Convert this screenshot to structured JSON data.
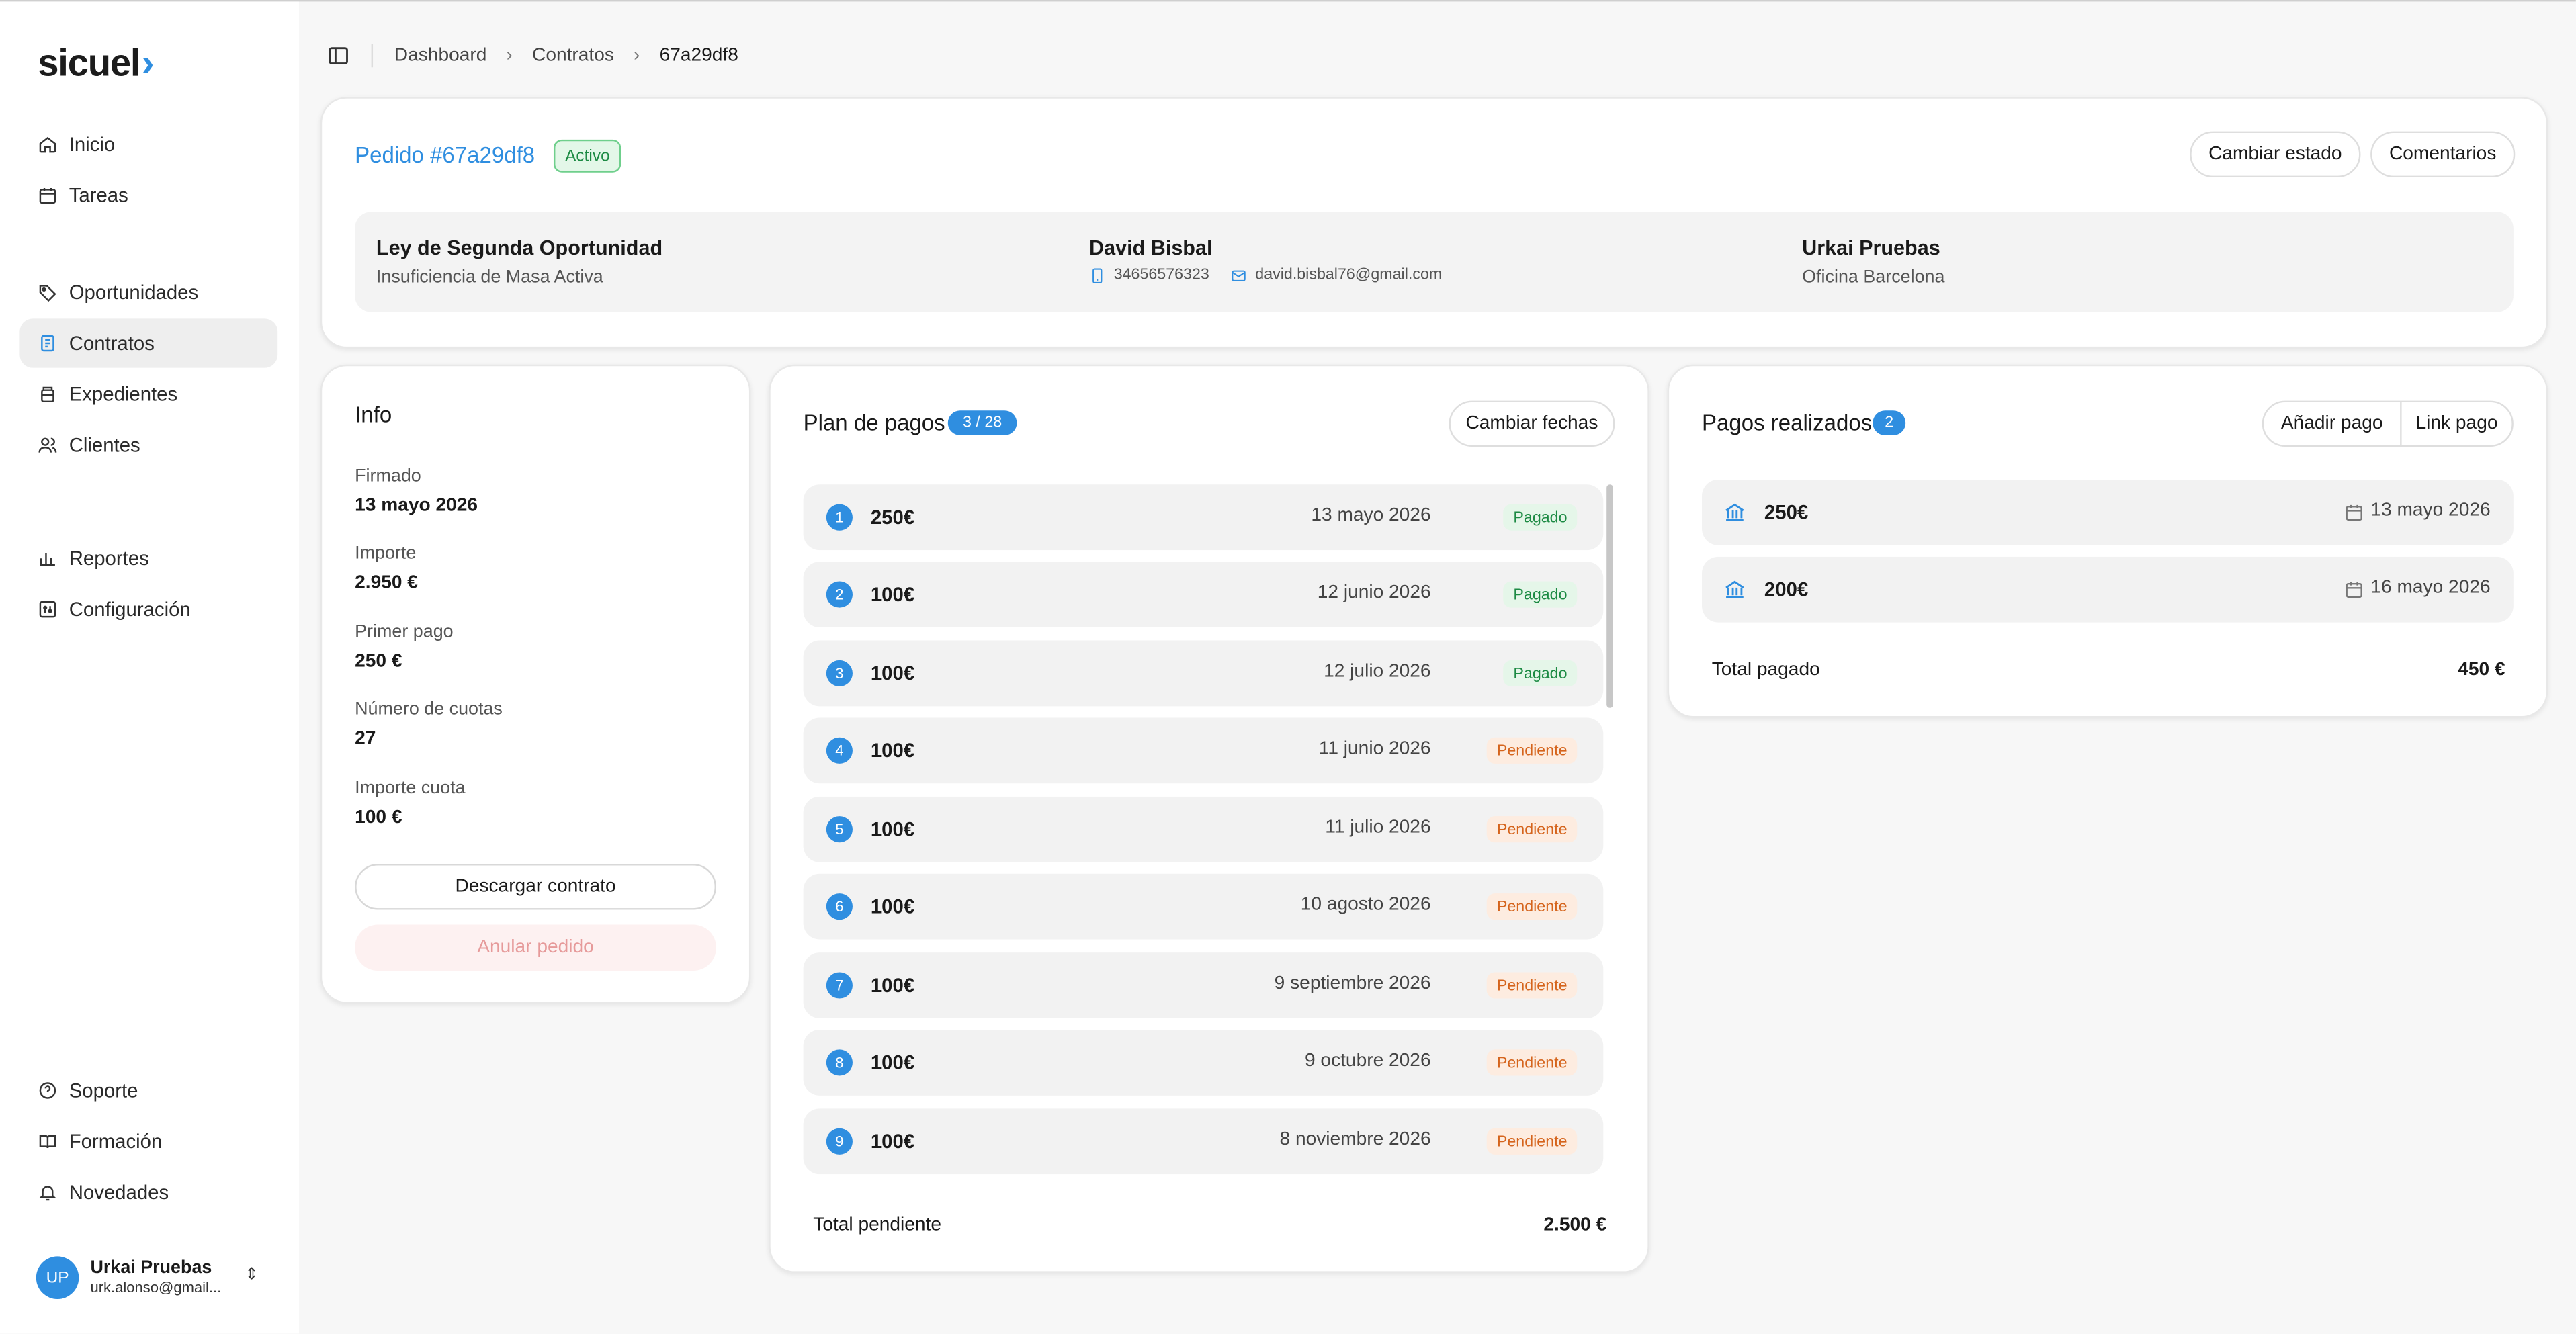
{
  "app": {
    "logo": "sicuel",
    "logo_chevron": "›"
  },
  "colors": {
    "accent": "#2f8ee0",
    "success": "#1c8a43",
    "warning": "#d5641c",
    "danger_soft": "#e69a9a"
  },
  "sidebar": {
    "items": [
      {
        "label": "Inicio",
        "icon": "home-icon"
      },
      {
        "label": "Tareas",
        "icon": "calendar-icon"
      },
      {
        "label": "Oportunidades",
        "icon": "tag-icon"
      },
      {
        "label": "Contratos",
        "icon": "contract-icon",
        "active": true
      },
      {
        "label": "Expedientes",
        "icon": "folder-stack-icon"
      },
      {
        "label": "Clientes",
        "icon": "users-icon"
      },
      {
        "label": "Reportes",
        "icon": "chart-icon"
      },
      {
        "label": "Configuración",
        "icon": "settings-panel-icon"
      },
      {
        "label": "Soporte",
        "icon": "help-circle-icon"
      },
      {
        "label": "Formación",
        "icon": "book-icon"
      },
      {
        "label": "Novedades",
        "icon": "bell-icon"
      }
    ],
    "user": {
      "initials": "UP",
      "name": "Urkai Pruebas",
      "email": "urk.alonso@gmail...",
      "switch_icon": "⇕"
    }
  },
  "breadcrumb": {
    "items": [
      "Dashboard",
      "Contratos"
    ],
    "current": "67a29df8",
    "separator": "›"
  },
  "order": {
    "title": "Pedido #67a29df8",
    "status": "Activo",
    "actions": {
      "change_status": "Cambiar estado",
      "comments": "Comentarios"
    },
    "service": {
      "title": "Ley de Segunda Oportunidad",
      "subtitle": "Insuficiencia de Masa Activa"
    },
    "client": {
      "name": "David Bisbal",
      "phone": "34656576323",
      "email": "david.bisbal76@gmail.com"
    },
    "agent": {
      "name": "Urkai Pruebas",
      "office": "Oficina Barcelona"
    }
  },
  "info": {
    "title": "Info",
    "fields": [
      {
        "label": "Firmado",
        "value": "13 mayo 2026"
      },
      {
        "label": "Importe",
        "value": "2.950 €"
      },
      {
        "label": "Primer pago",
        "value": "250 €"
      },
      {
        "label": "Número de cuotas",
        "value": "27"
      },
      {
        "label": "Importe cuota",
        "value": "100 €"
      }
    ],
    "download": "Descargar contrato",
    "cancel": "Anular pedido"
  },
  "plan": {
    "title": "Plan de pagos",
    "count": "3 / 28",
    "change_dates": "Cambiar fechas",
    "rows": [
      {
        "n": "1",
        "amount": "250€",
        "date": "13 mayo 2026",
        "status": "Pagado"
      },
      {
        "n": "2",
        "amount": "100€",
        "date": "12 junio 2026",
        "status": "Pagado"
      },
      {
        "n": "3",
        "amount": "100€",
        "date": "12 julio 2026",
        "status": "Pagado"
      },
      {
        "n": "4",
        "amount": "100€",
        "date": "11 junio 2026",
        "status": "Pendiente"
      },
      {
        "n": "5",
        "amount": "100€",
        "date": "11 julio 2026",
        "status": "Pendiente"
      },
      {
        "n": "6",
        "amount": "100€",
        "date": "10 agosto 2026",
        "status": "Pendiente"
      },
      {
        "n": "7",
        "amount": "100€",
        "date": "9 septiembre 2026",
        "status": "Pendiente"
      },
      {
        "n": "8",
        "amount": "100€",
        "date": "9 octubre 2026",
        "status": "Pendiente"
      },
      {
        "n": "9",
        "amount": "100€",
        "date": "8 noviembre 2026",
        "status": "Pendiente"
      }
    ],
    "total_label": "Total pendiente",
    "total_value": "2.500 €"
  },
  "payments": {
    "title": "Pagos realizados",
    "count": "2",
    "add": "Añadir pago",
    "link": "Link pago",
    "rows": [
      {
        "amount": "250€",
        "date": "13 mayo 2026"
      },
      {
        "amount": "200€",
        "date": "16 mayo 2026"
      }
    ],
    "total_label": "Total pagado",
    "total_value": "450 €"
  }
}
